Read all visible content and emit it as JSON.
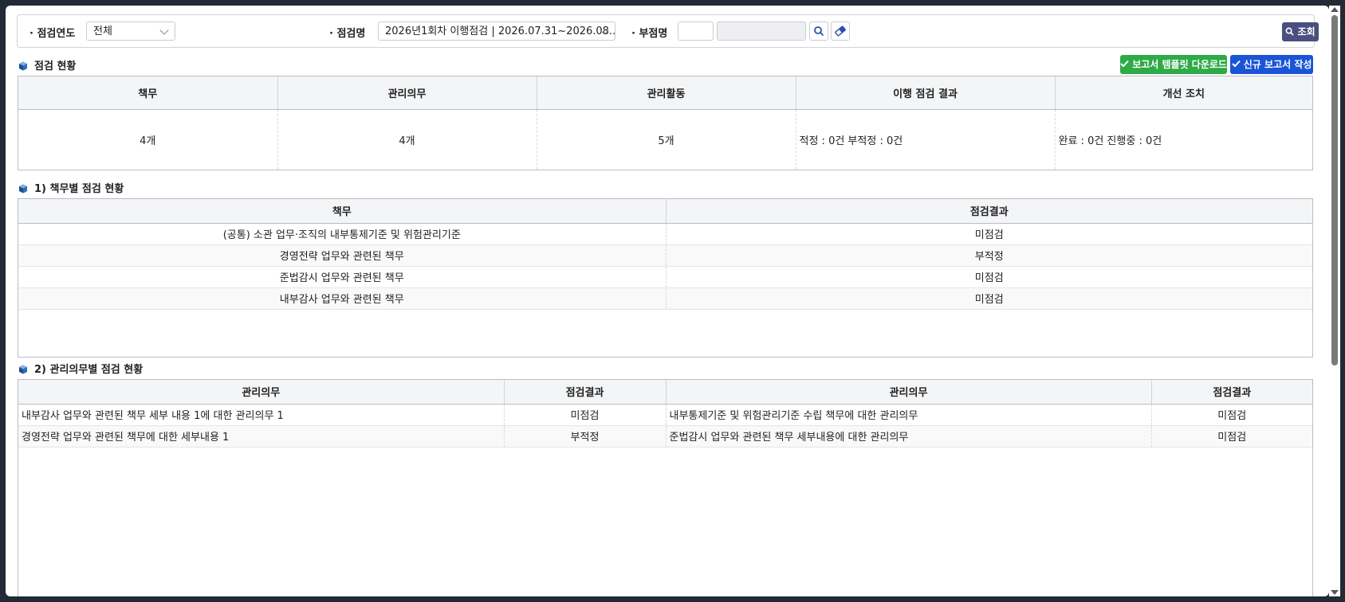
{
  "search": {
    "year_label": "· 점검연도",
    "year_value": "전체",
    "name_label": "· 점검명",
    "name_value": "2026년1회차 이행점검 | 2026.07.31~2026.08....",
    "dept_label": "· 부점명",
    "dept_code": "",
    "dept_name": "",
    "search_button": "조회"
  },
  "status": {
    "title": "점검 현황",
    "download_button": "보고서 템플릿 다운로드",
    "new_report_button": "신규 보고서 작성",
    "headers": [
      "책무",
      "관리의무",
      "관리활동",
      "이행 점검 결과",
      "개선 조치"
    ],
    "values": [
      "4개",
      "4개",
      "5개",
      "적정 : 0건 부적정 : 0건",
      "완료 : 0건 진행중 : 0건"
    ]
  },
  "duties": {
    "title": "1) 책무별 점검 현황",
    "headers": [
      "책무",
      "점검결과"
    ],
    "rows": [
      [
        "(공통) 소관 업무·조직의 내부통제기준 및 위험관리기준",
        "미점검"
      ],
      [
        "경영전략 업무와 관련된 책무",
        "부적정"
      ],
      [
        "준법감시 업무와 관련된 책무",
        "미점검"
      ],
      [
        "내부감사 업무와 관련된 책무",
        "미점검"
      ]
    ]
  },
  "obligations": {
    "title": "2) 관리의무별 점검 현황",
    "headers": [
      "관리의무",
      "점검결과",
      "관리의무",
      "점검결과"
    ],
    "rows": [
      [
        "내부감사 업무와 관련된 책무 세부 내용 1에 대한 관리의무 1",
        "미점검",
        "내부통제기준 및 위험관리기준 수립 책무에 대한 관리의무",
        "미점검"
      ],
      [
        "경영전략 업무와 관련된 책무에 대한 세부내용 1",
        "부적정",
        "준법감시 업무와 관련된 책무 세부내용에 대한 관리의무",
        "미점검"
      ]
    ]
  },
  "icons": [
    "search-icon",
    "eraser-icon",
    "check-icon",
    "cube-icon",
    "chevron-down-icon"
  ]
}
